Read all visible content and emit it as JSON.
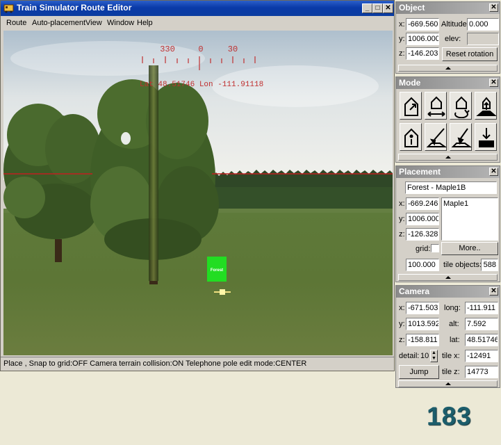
{
  "window": {
    "title": "Train Simulator Route Editor",
    "menu": [
      "Route",
      "Auto-placement",
      "View",
      "Window",
      "Help"
    ]
  },
  "viewport": {
    "compass_labels": [
      "330",
      "0",
      "30"
    ],
    "coords_text": "Lat 48.51746  Lon -111.91118",
    "object_marker_label": "Forest"
  },
  "status_text": "Place , Snap to grid:OFF Camera terrain collision:ON Telephone pole edit mode:CENTER",
  "object_panel": {
    "title": "Object",
    "x_label": "x:",
    "x": "-669.560",
    "y_label": "y:",
    "y": "1006.000",
    "z_label": "z:",
    "z": "-146.203",
    "altitude_label": "Altitude",
    "altitude": "0.000",
    "elev_label": "elev:",
    "elev": "",
    "reset_rotation": "Reset rotation"
  },
  "mode_panel": {
    "title": "Mode",
    "icons": [
      "move-object-icon",
      "slide-object-icon",
      "rotate-object-icon",
      "raise-terrain-icon",
      "object-info-icon",
      "terrain-brush-icon",
      "terrain-paint-icon",
      "drop-object-icon"
    ]
  },
  "placement_panel": {
    "title": "Placement",
    "selected_object": "Forest - Maple1B",
    "x_label": "x:",
    "x": "-669.246",
    "y_label": "y:",
    "y": "1006.000",
    "z_label": "z:",
    "z": "-126.328",
    "list_items": [
      "Maple1"
    ],
    "grid_label": "grid:",
    "more_button": "More..",
    "grid_size": "100.000",
    "tile_objects_label": "tile objects:",
    "tile_objects": "588"
  },
  "camera_panel": {
    "title": "Camera",
    "x_label": "x:",
    "x": "-671.503",
    "y_label": "y:",
    "y": "1013.592",
    "z_label": "z:",
    "z": "-158.811",
    "long_label": "long:",
    "long": "-111.911",
    "alt_label": "alt:",
    "alt": "7.592",
    "lat_label": "lat:",
    "lat": "48.51746",
    "detail_label": "detail:",
    "detail": "10",
    "tile_x_label": "tile x:",
    "tile_x": "-12491",
    "tile_z_label": "tile z:",
    "tile_z": "14773",
    "jump_button": "Jump"
  },
  "page_number": "183",
  "colors": {
    "titlebar": "#0a3aa8",
    "horizon_line": "#c02020",
    "compass_text": "#c03030",
    "object_marker": "#22dd22",
    "page_number": "#1c5d6b"
  }
}
